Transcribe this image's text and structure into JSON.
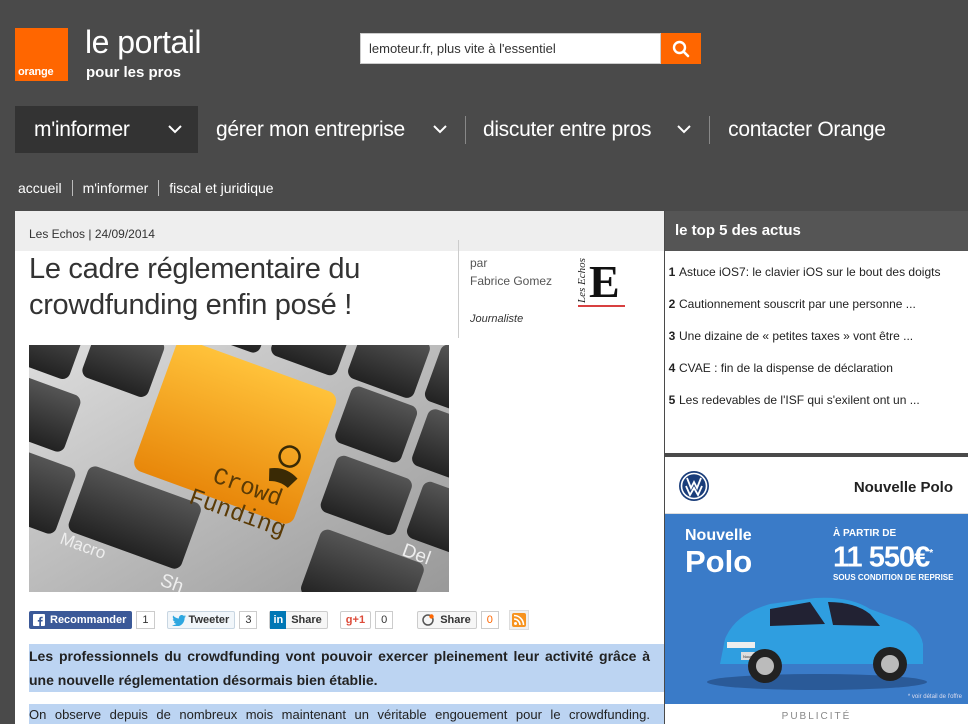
{
  "header": {
    "logo_text": "orange",
    "title": "le portail",
    "subtitle": "pour les pros",
    "search": {
      "placeholder": "lemoteur.fr, plus vite à l'essentiel"
    }
  },
  "nav": {
    "items": [
      {
        "label": "m'informer"
      },
      {
        "label": "gérer mon entreprise"
      },
      {
        "label": "discuter entre pros"
      },
      {
        "label": "contacter Orange"
      }
    ]
  },
  "breadcrumb": [
    "accueil",
    "m'informer",
    "fiscal et juridique"
  ],
  "article": {
    "source_date": "Les Echos | 24/09/2014",
    "title": "Le cadre réglementaire du crowdfunding enfin posé !",
    "author_prefix": "par",
    "author_name": "Fabrice Gomez",
    "author_role": "Journaliste",
    "image_keys": {
      "main": "Crowd\nFunding",
      "macro": "Macro",
      "delete": "Del",
      "shift": "Sh"
    },
    "social": {
      "facebook_label": "Recommander",
      "facebook_count": "1",
      "twitter_label": "Tweeter",
      "twitter_count": "3",
      "linkedin_label": "Share",
      "gplus_label": "+1",
      "gplus_count": "0",
      "share_label": "Share",
      "share_count": "0"
    },
    "lead": "Les professionnels du crowdfunding vont pouvoir exercer pleinement leur activité grâce à une nouvelle réglementation désormais bien établie.",
    "body": "On observe depuis de nombreux mois maintenant un véritable engouement pour le crowdfunding."
  },
  "sidebar": {
    "top5_title": "le top 5 des actus",
    "top5": [
      {
        "num": "1",
        "text": "Astuce iOS7: le clavier iOS sur le bout des doigts"
      },
      {
        "num": "2",
        "text": "Cautionnement souscrit par une personne ..."
      },
      {
        "num": "3",
        "text": "Une dizaine de « petites taxes » vont être ..."
      },
      {
        "num": "4",
        "text": "CVAE : fin de la dispense de déclaration"
      },
      {
        "num": "5",
        "text": "Les redevables de l'ISF qui s'exilent ont un ..."
      }
    ],
    "ad": {
      "brand_name": "Nouvelle Polo",
      "headline_1": "Nouvelle",
      "headline_2": "Polo",
      "price_prefix": "À PARTIR DE",
      "price": "11 550€",
      "price_asterisk": "*",
      "price_suffix": "SOUS CONDITION DE REPRISE",
      "plate": "Nouvelle Polo",
      "fine_print": "* voir détail de l'offre",
      "label": "PUBLICITÉ"
    }
  },
  "colors": {
    "brand_orange": "#ff6600",
    "header_bg": "#4a4a4a",
    "highlight": "#bcd4f2",
    "ad_blue": "#3a7bc8"
  }
}
